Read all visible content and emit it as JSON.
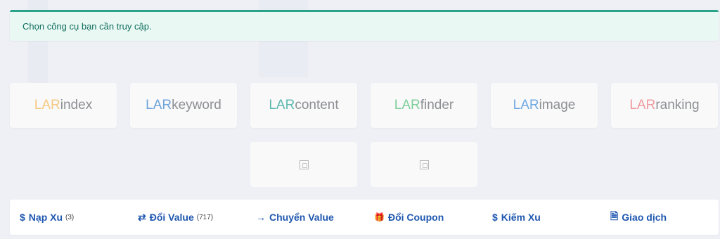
{
  "notice": {
    "text": "Chọn công cụ bạn cần truy cập."
  },
  "tools": [
    {
      "brand": "LAR",
      "name": "index",
      "brand_color": "#f4c983"
    },
    {
      "brand": "LAR",
      "name": "keyword",
      "brand_color": "#6ea4d8"
    },
    {
      "brand": "LAR",
      "name": "content",
      "brand_color": "#5fb8b0"
    },
    {
      "brand": "LAR",
      "name": "finder",
      "brand_color": "#7fcf9a"
    },
    {
      "brand": "LAR",
      "name": "image",
      "brand_color": "#6fa8e2"
    },
    {
      "brand": "LAR",
      "name": "ranking",
      "brand_color": "#ee9a9e"
    }
  ],
  "placeholders": [
    {
      "icon": "broken-image-icon"
    },
    {
      "icon": "broken-image-icon"
    }
  ],
  "links": [
    {
      "icon": "$",
      "label": "Nạp Xu",
      "count": "(3)"
    },
    {
      "icon": "⇄",
      "label": "Đổi Value",
      "count": "(717)"
    },
    {
      "icon": "→",
      "label": "Chuyển Value",
      "count": ""
    },
    {
      "icon": "🎁",
      "label": "Đổi Coupon",
      "count": ""
    },
    {
      "icon": "$",
      "label": "Kiếm Xu",
      "count": ""
    },
    {
      "icon": "🗎",
      "label": "Giao dịch",
      "count": ""
    }
  ],
  "colors": {
    "accent": "#2aa389",
    "link": "#1f57b0"
  }
}
